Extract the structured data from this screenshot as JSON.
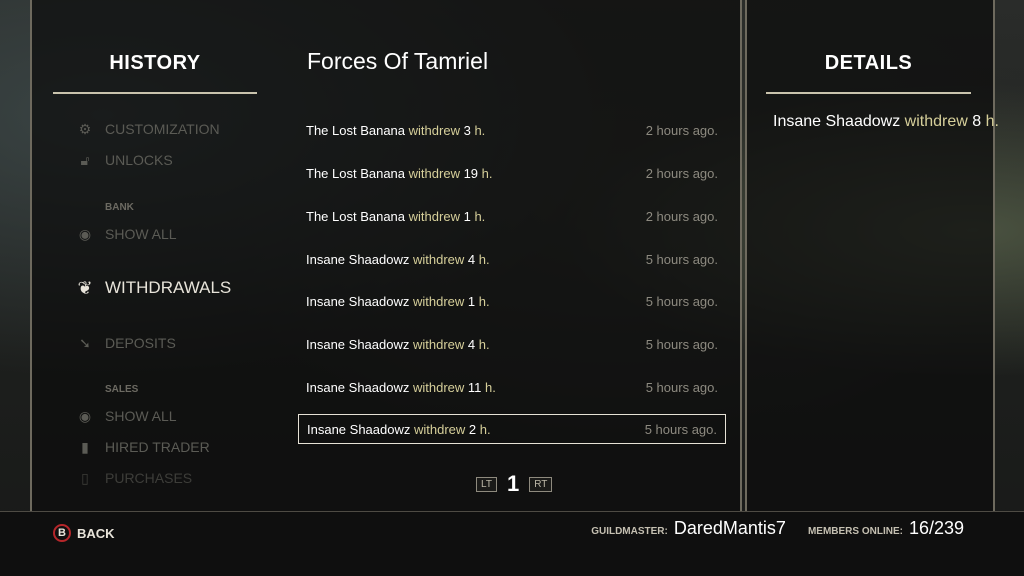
{
  "left": {
    "title": "HISTORY",
    "categories": [
      {
        "label": "CUSTOMIZATION",
        "icon": "gears-icon",
        "active": false
      },
      {
        "label": "UNLOCKS",
        "icon": "lock-icon",
        "active": false
      },
      {
        "label": "SHOW ALL",
        "icon": "eye-icon",
        "active": false
      },
      {
        "label": "WITHDRAWALS",
        "icon": "withdraw-icon",
        "active": true
      },
      {
        "label": "DEPOSITS",
        "icon": "deposit-icon",
        "active": false
      },
      {
        "label": "SHOW ALL",
        "icon": "eye-icon",
        "active": false
      },
      {
        "label": "HIRED TRADER",
        "icon": "trader-icon",
        "active": false
      },
      {
        "label": "PURCHASES",
        "icon": "purchases-icon",
        "active": false
      }
    ],
    "headers": {
      "bank": "BANK",
      "sales": "SALES"
    }
  },
  "main": {
    "guild_name": "Forces Of Tamriel",
    "rows": [
      {
        "who": "The Lost Banana",
        "verb": "withdrew",
        "amount": "3",
        "unit": "h.",
        "time": "2 hours ago."
      },
      {
        "who": "The Lost Banana",
        "verb": "withdrew",
        "amount": "19",
        "unit": "h.",
        "time": "2 hours ago."
      },
      {
        "who": "The Lost Banana",
        "verb": "withdrew",
        "amount": "1",
        "unit": "h.",
        "time": "2 hours ago."
      },
      {
        "who": "Insane Shaadowz",
        "verb": "withdrew",
        "amount": "4",
        "unit": "h.",
        "time": "5 hours ago."
      },
      {
        "who": "Insane Shaadowz",
        "verb": "withdrew",
        "amount": "1",
        "unit": "h.",
        "time": "5 hours ago."
      },
      {
        "who": "Insane Shaadowz",
        "verb": "withdrew",
        "amount": "4",
        "unit": "h.",
        "time": "5 hours ago."
      },
      {
        "who": "Insane Shaadowz",
        "verb": "withdrew",
        "amount": "11",
        "unit": "h.",
        "time": "5 hours ago."
      },
      {
        "who": "Insane Shaadowz",
        "verb": "withdrew",
        "amount": "2",
        "unit": "h.",
        "time": "5 hours ago.",
        "selected": true
      }
    ],
    "pager": {
      "prev": "LT",
      "page": "1",
      "next": "RT"
    }
  },
  "details": {
    "title": "DETAILS",
    "who": "Insane Shaadowz",
    "verb": "withdrew",
    "amount": "8",
    "unit": "h."
  },
  "footer": {
    "back_key": "B",
    "back_label": "BACK",
    "guildmaster_label": "GUILDMASTER:",
    "guildmaster_value": "DaredMantis7",
    "members_label": "MEMBERS ONLINE:",
    "members_value": "16/239"
  },
  "colors": {
    "accent_text": "#d6cf9a",
    "back_ring": "#b5262a",
    "rule": "#c9c3ad"
  }
}
